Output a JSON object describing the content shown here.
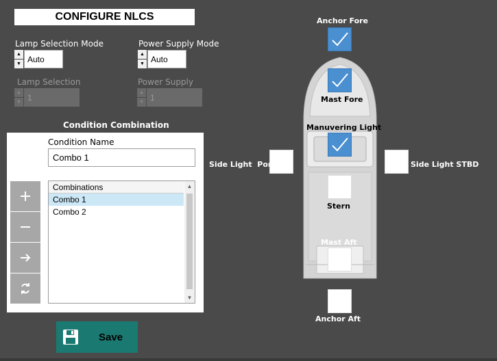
{
  "title": "CONFIGURE NLCS",
  "lamp_selection_mode": {
    "label": "Lamp Selection Mode",
    "value": "Auto"
  },
  "power_supply_mode": {
    "label": "Power Supply Mode",
    "value": "Auto"
  },
  "lamp_selection": {
    "label": "Lamp Selection",
    "value": "1"
  },
  "power_supply": {
    "label": "Power Supply",
    "value": "1"
  },
  "condition_combination": {
    "title": "Condition Combination",
    "name_label": "Condition Name",
    "name_value": "Combo 1",
    "list_header": "Combinations",
    "items": [
      "Combo 1",
      "Combo 2"
    ],
    "selected_index": 0
  },
  "buttons": {
    "add_icon": "plus-icon",
    "remove_icon": "minus-icon",
    "apply_icon": "arrow-right-icon",
    "refresh_icon": "refresh-icon"
  },
  "save_label": "Save",
  "lights": {
    "anchor_fore": {
      "label": "Anchor Fore",
      "on": true
    },
    "mast_fore": {
      "label": "Mast Fore",
      "on": true
    },
    "manuvering": {
      "label": "Manuvering Light",
      "on": true
    },
    "side_port": {
      "label": "Side Light  Port",
      "on": false
    },
    "side_stbd": {
      "label": "Side Light STBD",
      "on": false
    },
    "stern": {
      "label": "Stern",
      "on": false
    },
    "mast_aft": {
      "label": "Mast Aft",
      "on": false
    },
    "anchor_aft": {
      "label": "Anchor Aft",
      "on": false
    }
  },
  "colors": {
    "background": "#4a4a4a",
    "accent_teal": "#1a7a72",
    "light_on": "#4a8fd0",
    "selection": "#cce8f7"
  }
}
